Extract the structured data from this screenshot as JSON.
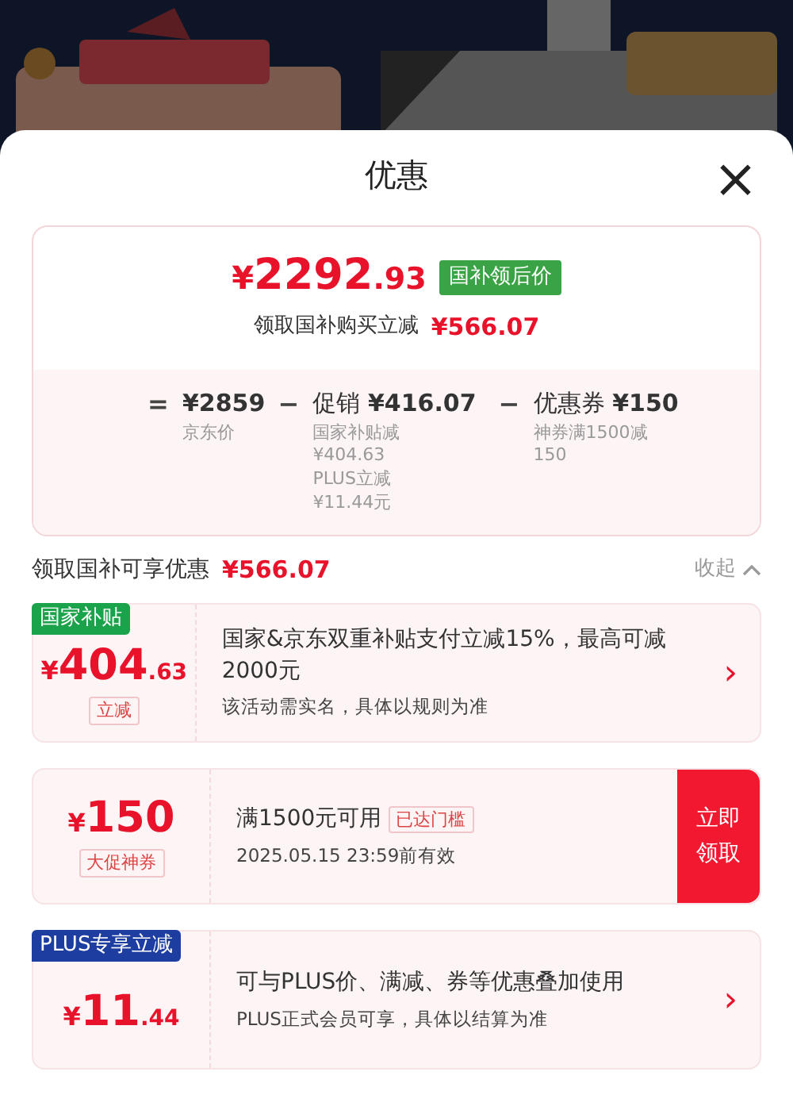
{
  "sheet": {
    "title": "优惠",
    "close": "×"
  },
  "summary": {
    "currency": "¥",
    "price_int": "2292",
    "price_dec": ".93",
    "price_tag": "国补领后价",
    "saving_label": "领取国补购买立减",
    "saving_amount": "¥566.07",
    "breakdown": [
      {
        "op": "=",
        "value": "¥2859",
        "notes": [
          "京东价"
        ]
      },
      {
        "op": "−",
        "prefix": "促销",
        "value": "¥416.07",
        "notes": [
          "国家补贴减",
          "¥404.63",
          "PLUS立减",
          "¥11.44元"
        ]
      },
      {
        "op": "−",
        "prefix": "优惠券",
        "value": "¥150",
        "notes": [
          "神券满1500减",
          "150"
        ]
      }
    ]
  },
  "section": {
    "label": "领取国补可享优惠",
    "amount": "¥566.07",
    "toggle": "收起",
    "expanded": true
  },
  "offers": [
    {
      "kind": "subsidy",
      "tag": {
        "text": "国家补贴",
        "color": "#1aa34a"
      },
      "currency": "¥",
      "amount_int": "404",
      "amount_dec": ".63",
      "badge": "立减",
      "title": "国家&京东双重补贴支付立减15%，最高可减2000元",
      "subtitle": "该活动需实名，具体以规则为准",
      "action": {
        "kind": "chevron",
        "text": "›"
      }
    },
    {
      "kind": "coupon",
      "currency": "¥",
      "amount_int": "150",
      "badge": "大促神券",
      "title": "满1500元可用",
      "title_badge": "已达门槛",
      "subtitle": "2025.05.15 23:59前有效",
      "action": {
        "kind": "claim",
        "text": "立即领取"
      }
    },
    {
      "kind": "plus",
      "tag": {
        "text": "PLUS专享立减",
        "color": "#1d3ea0"
      },
      "currency": "¥",
      "amount_int": "11",
      "amount_dec": ".44",
      "title": "可与PLUS价、满减、券等优惠叠加使用",
      "subtitle": "PLUS正式会员可享，具体以结算为准",
      "action": {
        "kind": "chevron",
        "text": "›"
      }
    }
  ]
}
